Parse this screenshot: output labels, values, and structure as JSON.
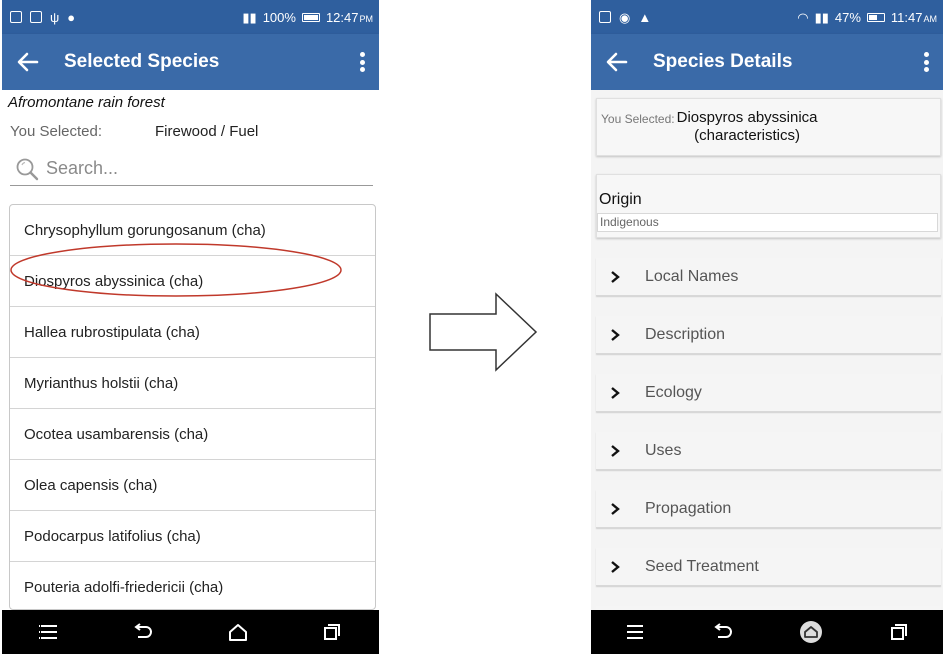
{
  "left_phone": {
    "status": {
      "battery": "100%",
      "time": "12:47",
      "ampm": "PM"
    },
    "appbar": {
      "title": "Selected Species"
    },
    "forest_type": "Afromontane rain forest",
    "selection": {
      "label": "You Selected:",
      "value": "Firewood / Fuel"
    },
    "search": {
      "placeholder": "Search..."
    },
    "species": [
      "Chrysophyllum gorungosanum (cha)",
      "Diospyros abyssinica (cha)",
      "Hallea rubrostipulata (cha)",
      "Myrianthus holstii (cha)",
      "Ocotea usambarensis (cha)",
      "Olea capensis (cha)",
      "Podocarpus latifolius (cha)",
      "Pouteria adolfi-friedericii (cha)"
    ],
    "highlighted_index": 1
  },
  "right_phone": {
    "status": {
      "battery": "47%",
      "time": "11:47",
      "ampm": "AM"
    },
    "appbar": {
      "title": "Species Details"
    },
    "selection": {
      "label": "You Selected:",
      "value_line1": "Diospyros abyssinica",
      "value_line2": "(characteristics)"
    },
    "origin": {
      "label": "Origin",
      "value": "Indigenous"
    },
    "sections": [
      "Local Names",
      "Description",
      "Ecology",
      "Uses",
      "Propagation",
      "Seed Treatment"
    ]
  },
  "colors": {
    "appbar": "#3a6aa8",
    "statusbar": "#2f5f9e",
    "highlight": "#c0392b"
  },
  "icons": [
    "back-arrow-icon",
    "kebab-menu-icon",
    "search-icon",
    "chevron-right-icon",
    "menu-lines-icon",
    "back-nav-icon",
    "home-icon",
    "recents-icon",
    "right-arrow-icon"
  ]
}
